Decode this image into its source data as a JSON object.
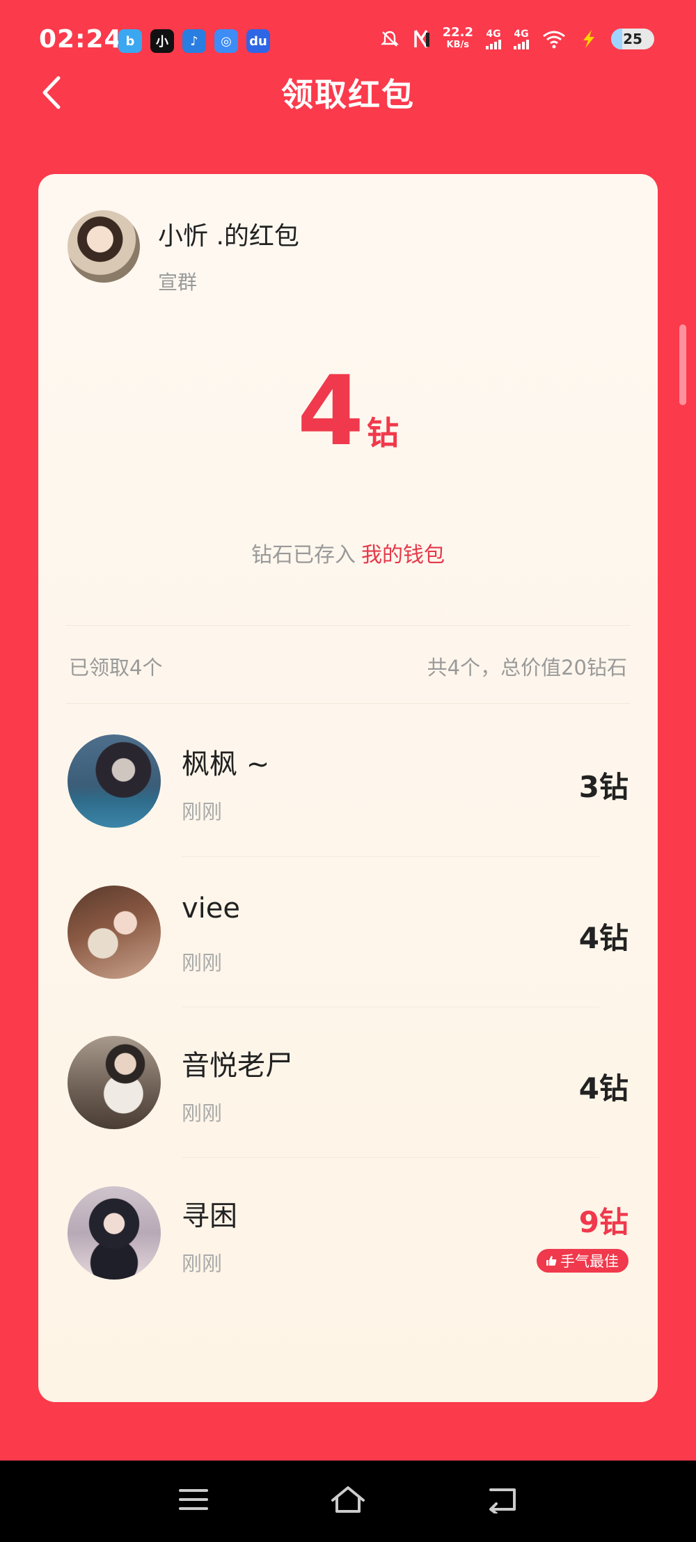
{
  "status_bar": {
    "time": "02:24",
    "net_speed_value": "22.2",
    "net_speed_unit": "KB/s",
    "sim1": "4G",
    "sim2": "4G",
    "battery": "25"
  },
  "header": {
    "title": "领取红包"
  },
  "sender": {
    "name": "小忻 .的红包",
    "group": "宣群"
  },
  "amount": {
    "value": "4",
    "unit": "钻"
  },
  "wallet": {
    "note": "钻石已存入",
    "link": "我的钱包"
  },
  "summary": {
    "claimed": "已领取4个",
    "total": "共4个，总价值20钻石"
  },
  "receivers": [
    {
      "name": "枫枫 ~",
      "time": "刚刚",
      "amount": "3钻"
    },
    {
      "name": "viee",
      "time": "刚刚",
      "amount": "4钻"
    },
    {
      "name": "音悦老尸",
      "time": "刚刚",
      "amount": "4钻"
    },
    {
      "name": "寻困",
      "time": "刚刚",
      "amount": "9钻",
      "badge": "手气最佳"
    }
  ],
  "colors": {
    "background": "#fb3a4c",
    "accent": "#f0394c",
    "card": "#fef6ec"
  }
}
